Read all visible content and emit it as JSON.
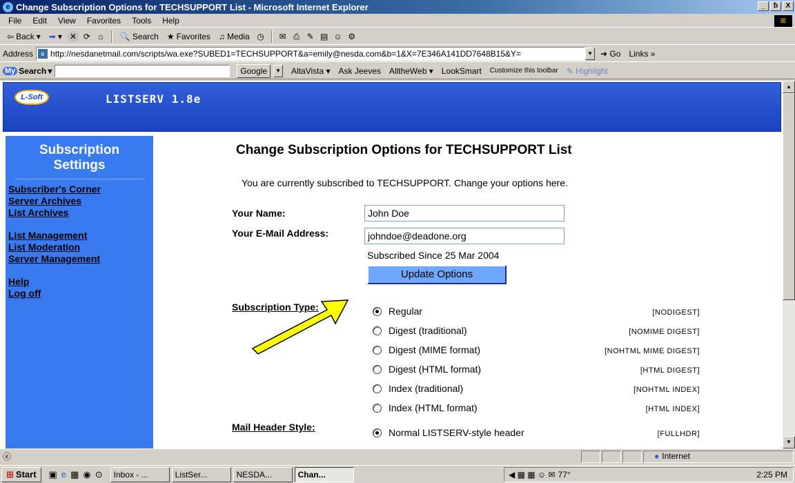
{
  "window": {
    "title": "Change Subscription Options for TECHSUPPORT List - Microsoft Internet Explorer",
    "controls": [
      "_",
      "ƀ",
      "X"
    ]
  },
  "menu": [
    "File",
    "Edit",
    "View",
    "Favorites",
    "Tools",
    "Help"
  ],
  "toolbar": {
    "back": "Back",
    "search": "Search",
    "favorites": "Favorites",
    "media": "Media"
  },
  "address": {
    "label": "Address",
    "url": "http://nesdanetmail.com/scripts/wa.exe?SUBED1=TECHSUPPORT&a=emily@nesda.com&b=1&X=7E346A141DD7648B15&Y=",
    "go": "Go",
    "links": "Links"
  },
  "searchbar": {
    "label": "Search",
    "google": "Google",
    "items": [
      "AltaVista",
      "Ask Jeeves",
      "AlltheWeb",
      "LookSmart",
      "Customize this toolbar"
    ],
    "highlight": "Highlight"
  },
  "banner": {
    "logo": "L-Soft",
    "product": "LISTSERV 1.8e"
  },
  "sidebar": {
    "title_line1": "Subscription",
    "title_line2": "Settings",
    "links1": [
      "Subscriber's Corner",
      "Server Archives",
      "List Archives"
    ],
    "links2": [
      "List Management",
      "List Moderation",
      "Server Management"
    ],
    "links3": [
      "Help",
      "Log off"
    ]
  },
  "main": {
    "heading": "Change Subscription Options for TECHSUPPORT List",
    "intro": "You are currently subscribed to TECHSUPPORT. Change your options here.",
    "name_label": "Your Name:",
    "name_value": "John Doe",
    "email_label": "Your E-Mail Address:",
    "email_value": "johndoe@deadone.org",
    "since": "Subscribed Since 25 Mar 2004",
    "update_button": "Update Options",
    "sub_type_label": "Subscription Type:",
    "sub_options": [
      {
        "label": "Regular",
        "code": "[NODIGEST]",
        "selected": true
      },
      {
        "label": "Digest (traditional)",
        "code": "[NOMIME DIGEST]",
        "selected": false
      },
      {
        "label": "Digest (MIME format)",
        "code": "[NOHTML MIME DIGEST]",
        "selected": false
      },
      {
        "label": "Digest (HTML format)",
        "code": "[HTML DIGEST]",
        "selected": false
      },
      {
        "label": "Index (traditional)",
        "code": "[NOHTML INDEX]",
        "selected": false
      },
      {
        "label": "Index (HTML format)",
        "code": "[HTML INDEX]",
        "selected": false
      }
    ],
    "mail_header_label": "Mail Header Style:",
    "header_option": {
      "label": "Normal LISTSERV-style header",
      "code": "[FULLHDR]",
      "selected": true
    }
  },
  "status": {
    "zone": "Internet"
  },
  "taskbar": {
    "start": "Start",
    "tasks": [
      "Inbox - ...",
      "ListSer...",
      "NESDA...",
      "Chan..."
    ],
    "temp": "77°",
    "time": "2:25 PM"
  },
  "colors": {
    "sidebar": "#3a7af0",
    "banner": "#1a43c0",
    "arrow": "#ffff00"
  }
}
